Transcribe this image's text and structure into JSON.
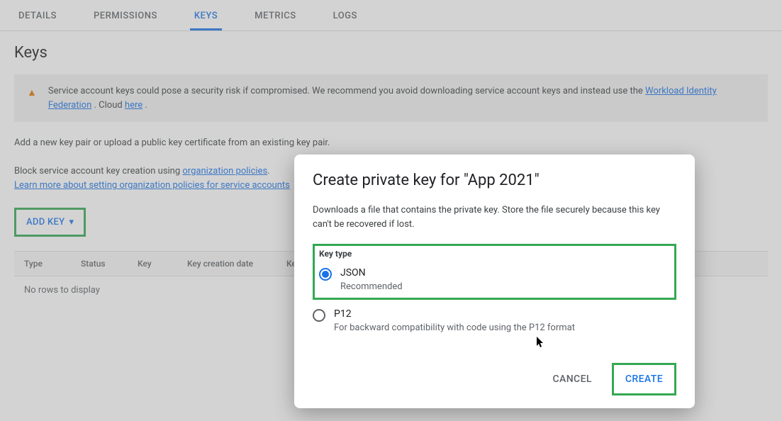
{
  "tabs": {
    "details": "DETAILS",
    "permissions": "PERMISSIONS",
    "keys": "KEYS",
    "metrics": "METRICS",
    "logs": "LOGS"
  },
  "page": {
    "title": "Keys",
    "warning_text1": "Service account keys could pose a security risk if compromised. We recommend you avoid downloading service account keys and instead use the ",
    "warning_link1": "Workload Identity Federation",
    "warning_text2": " . Cloud ",
    "warning_link2": "here",
    "warning_text3": " .",
    "helper": "Add a new key pair or upload a public key certificate from an existing key pair.",
    "block_text1": "Block service account key creation using ",
    "block_link1": "organization policies",
    "block_text2": ".",
    "block_link2": "Learn more about setting organization policies for service accounts",
    "add_key": "ADD KEY"
  },
  "table": {
    "headers": {
      "type": "Type",
      "status": "Status",
      "key": "Key",
      "creation": "Key creation date",
      "expiration": "Key expiration"
    },
    "empty": "No rows to display"
  },
  "modal": {
    "title": "Create private key for \"App 2021\"",
    "description": "Downloads a file that contains the private key. Store the file securely because this key can't be recovered if lost.",
    "keytype_label": "Key type",
    "json": {
      "label": "JSON",
      "sub": "Recommended"
    },
    "p12": {
      "label": "P12",
      "sub": "For backward compatibility with code using the P12 format"
    },
    "cancel": "CANCEL",
    "create": "CREATE"
  }
}
